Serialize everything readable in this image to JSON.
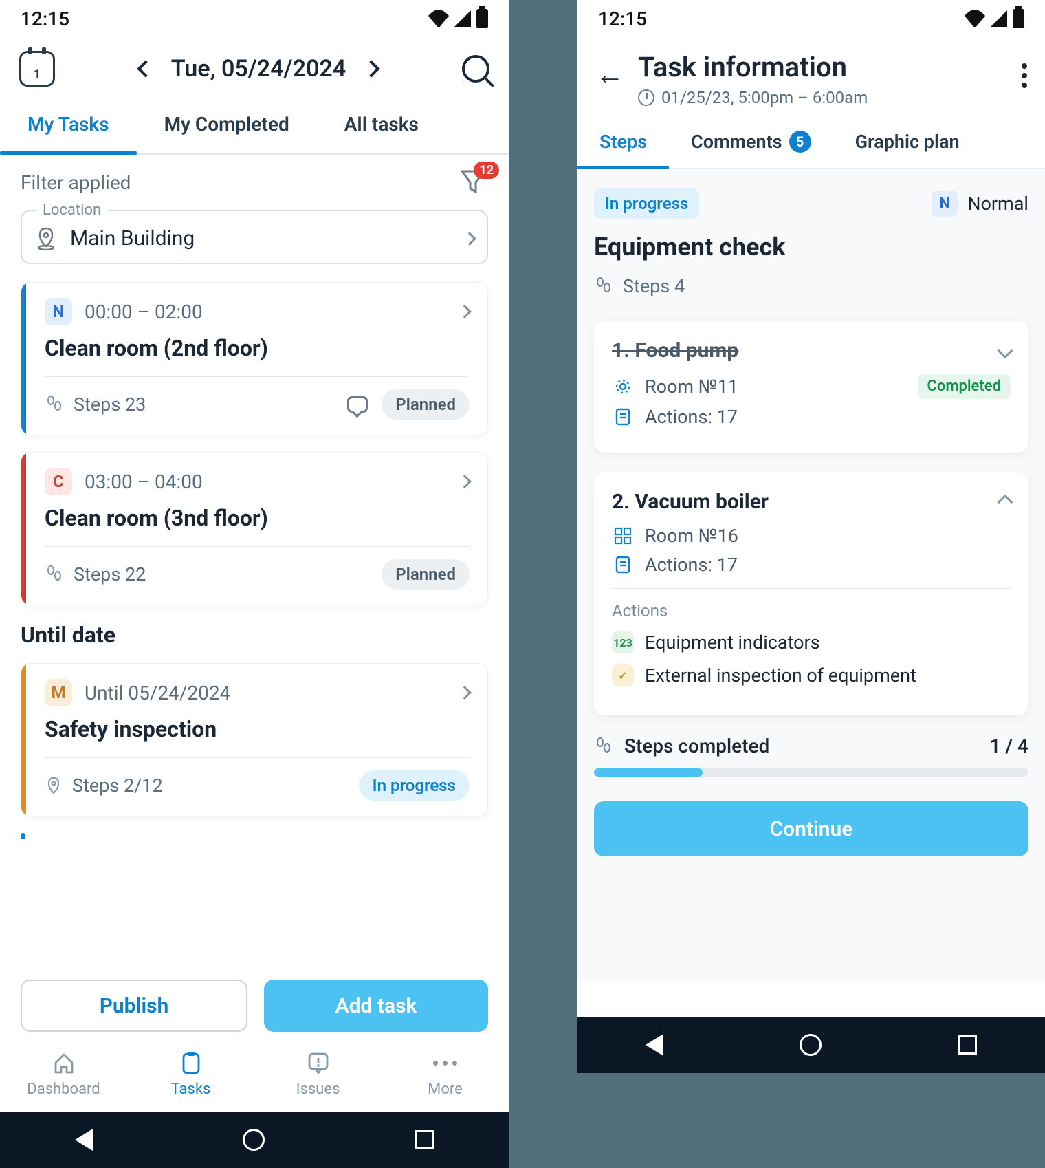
{
  "status_time": "12:15",
  "left": {
    "calendar_num": "1",
    "date": "Tue, 05/24/2024",
    "tabs": [
      "My Tasks",
      "My Completed",
      "All tasks"
    ],
    "filter_label": "Filter applied",
    "filter_count": "12",
    "location": {
      "label": "Location",
      "value": "Main Building"
    },
    "tasks": [
      {
        "priority": "N",
        "pclass": "n",
        "stripe": "blue",
        "time": "00:00 – 02:00",
        "title": "Clean room (2nd floor)",
        "steps": "Steps 23",
        "status": "Planned",
        "has_comment": true
      },
      {
        "priority": "C",
        "pclass": "c",
        "stripe": "red",
        "time": "03:00 – 04:00",
        "title": "Clean room (3nd floor)",
        "steps": "Steps 22",
        "status": "Planned",
        "has_comment": false
      }
    ],
    "section": "Until date",
    "until_task": {
      "priority": "M",
      "pclass": "m",
      "stripe": "orange",
      "time": "Until 05/24/2024",
      "title": "Safety inspection",
      "steps": "Steps 2/12",
      "status": "In progress"
    },
    "buttons": {
      "publish": "Publish",
      "add": "Add task"
    },
    "nav": [
      "Dashboard",
      "Tasks",
      "Issues",
      "More"
    ]
  },
  "right": {
    "title": "Task information",
    "subtitle": "01/25/23, 5:00pm – 6:00am",
    "tabs": {
      "steps": "Steps",
      "comments": "Comments",
      "comments_count": "5",
      "plan": "Graphic plan"
    },
    "status": "In progress",
    "priority": {
      "code": "N",
      "label": "Normal"
    },
    "heading": "Equipment check",
    "steps_total": "Steps 4",
    "items": [
      {
        "num": "1.",
        "name": "Food pump",
        "room": "Room №11",
        "actions": "Actions: 17",
        "completed": true,
        "badge": "Completed",
        "expanded": false
      },
      {
        "num": "2.",
        "name": "Vacuum boiler",
        "room": "Room №16",
        "actions": "Actions: 17",
        "completed": false,
        "expanded": true,
        "actions_label": "Actions",
        "action_items": [
          {
            "icon": "123",
            "cls": "g",
            "label": "Equipment indicators"
          },
          {
            "icon": "✓",
            "cls": "y",
            "label": "External inspection of equipment"
          }
        ]
      }
    ],
    "progress": {
      "label": "Steps completed",
      "value": "1 / 4",
      "pct": 25
    },
    "continue": "Continue"
  }
}
